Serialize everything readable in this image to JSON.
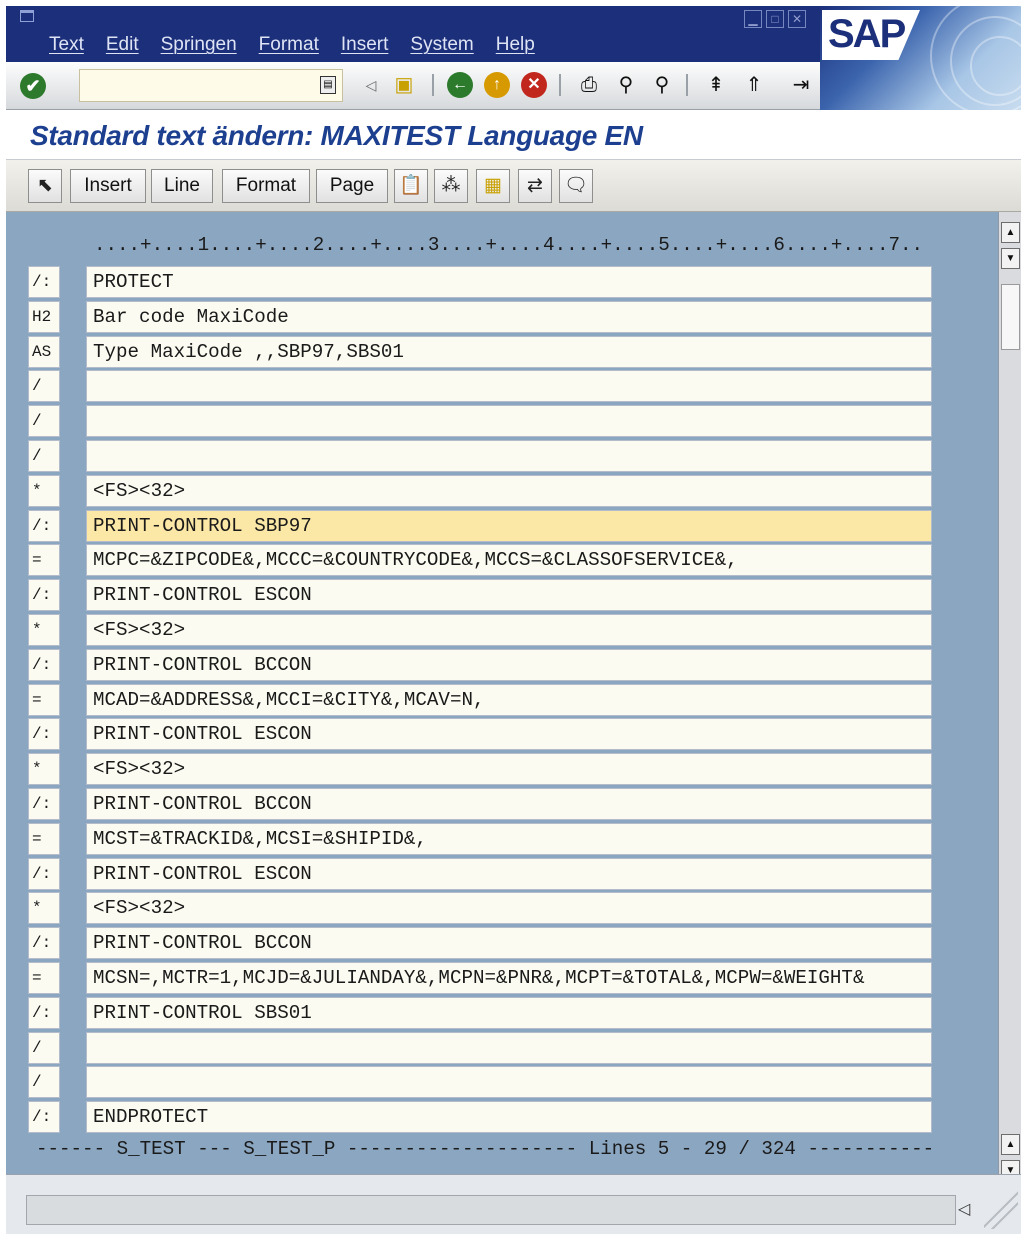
{
  "menubar": {
    "items": [
      "Text",
      "Edit",
      "Springen",
      "Format",
      "Insert",
      "System",
      "Help"
    ]
  },
  "logo": "SAP",
  "command_field": {
    "value": "",
    "placeholder": ""
  },
  "title": "Standard text ändern: MAXITEST Language EN",
  "app_toolbar": {
    "insert": "Insert",
    "line": "Line",
    "format": "Format",
    "page": "Page"
  },
  "editor": {
    "ruler": "....+....1....+....2....+....3....+....4....+....5....+....6....+....7..",
    "lines": [
      {
        "fmt": "/:",
        "text": "PROTECT"
      },
      {
        "fmt": "H2",
        "text": "Bar code MaxiCode"
      },
      {
        "fmt": "AS",
        "text": "Type MaxiCode ,,SBP97,SBS01"
      },
      {
        "fmt": "/",
        "text": ""
      },
      {
        "fmt": "/",
        "text": ""
      },
      {
        "fmt": "/",
        "text": ""
      },
      {
        "fmt": "*",
        "text": "<FS><32>"
      },
      {
        "fmt": "/:",
        "text": "PRINT-CONTROL SBP97"
      },
      {
        "fmt": "=",
        "text": "MCPC=&ZIPCODE&,MCCC=&COUNTRYCODE&,MCCS=&CLASSOFSERVICE&,"
      },
      {
        "fmt": "/:",
        "text": "PRINT-CONTROL ESCON"
      },
      {
        "fmt": "*",
        "text": "<FS><32>"
      },
      {
        "fmt": "/:",
        "text": "PRINT-CONTROL BCCON"
      },
      {
        "fmt": "=",
        "text": "MCAD=&ADDRESS&,MCCI=&CITY&,MCAV=N,"
      },
      {
        "fmt": "/:",
        "text": "PRINT-CONTROL ESCON"
      },
      {
        "fmt": "*",
        "text": "<FS><32>"
      },
      {
        "fmt": "/:",
        "text": "PRINT-CONTROL BCCON"
      },
      {
        "fmt": "=",
        "text": "MCST=&TRACKID&,MCSI=&SHIPID&,"
      },
      {
        "fmt": "/:",
        "text": "PRINT-CONTROL ESCON"
      },
      {
        "fmt": "*",
        "text": "<FS><32>"
      },
      {
        "fmt": "/:",
        "text": "PRINT-CONTROL BCCON"
      },
      {
        "fmt": "=",
        "text": "MCSN=,MCTR=1,MCJD=&JULIANDAY&,MCPN=&PNR&,MCPT=&TOTAL&,MCPW=&WEIGHT&"
      },
      {
        "fmt": "/:",
        "text": "PRINT-CONTROL SBS01"
      },
      {
        "fmt": "/",
        "text": ""
      },
      {
        "fmt": "/",
        "text": ""
      },
      {
        "fmt": "/:",
        "text": "ENDPROTECT"
      }
    ],
    "active_line": 8,
    "status_line": "------ S_TEST --- S_TEST_P -------------------- Lines 5 - 29 / 324 -----------"
  },
  "colors": {
    "menubar_bg": "#1c2f7b",
    "title_text": "#1c3f8f",
    "editor_bg": "#8ba6c0",
    "line_bg": "#fbfbf1",
    "active_line_bg": "#fbe7a6"
  }
}
